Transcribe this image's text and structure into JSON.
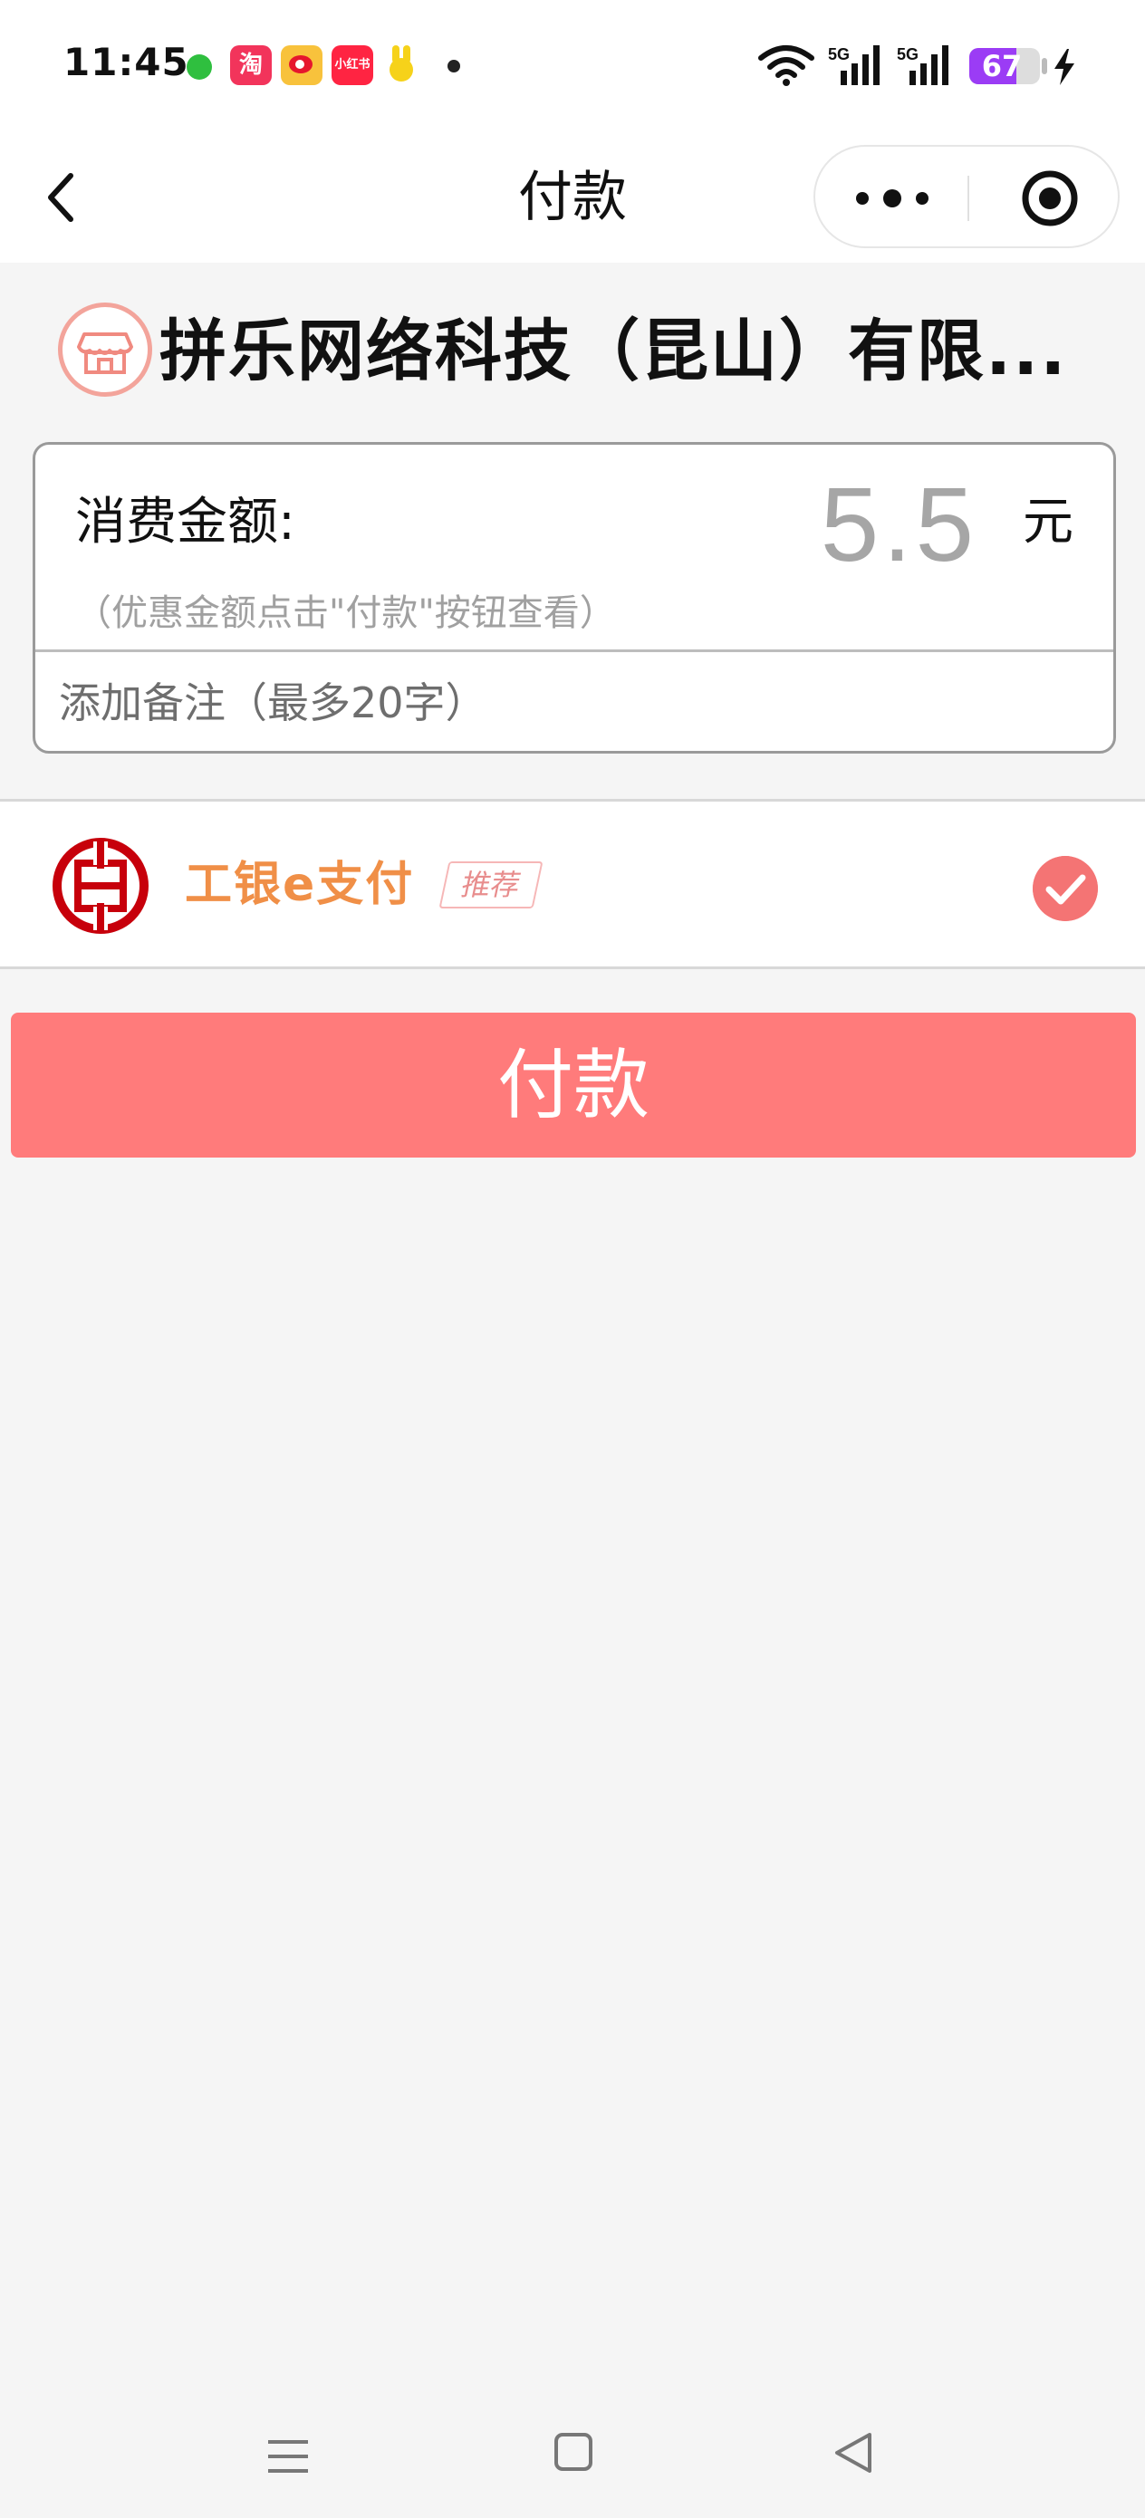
{
  "status_bar": {
    "time": "11:45",
    "notifications": [
      "message-icon",
      "taobao-icon",
      "weibo-icon",
      "xiaohongshu-icon",
      "rabbit-app-icon"
    ],
    "taobao_label": "淘",
    "xhs_label": "小红书",
    "network_1": "5G",
    "network_2": "5G",
    "battery": "67",
    "battery_level": 0.67,
    "charging": true
  },
  "nav": {
    "title": "付款"
  },
  "merchant": {
    "name": "拼乐网络科技（昆山）有限...",
    "logo": "store-icon"
  },
  "amount": {
    "label": "消费金额:",
    "value": "5.5",
    "unit": "元",
    "hint": "（优惠金额点击\"付款\"按钮查看）"
  },
  "remark": {
    "placeholder": "添加备注（最多20字）"
  },
  "payment_method": {
    "name": "工银e支付",
    "badge": "推荐",
    "selected": true
  },
  "pay_button": {
    "label": "付款"
  },
  "colors": {
    "accent": "#ff7b7b",
    "check": "#f47474",
    "icbc_red": "#c7000b",
    "pay_name": "#f08f47",
    "battery": "#9b3cf5"
  }
}
